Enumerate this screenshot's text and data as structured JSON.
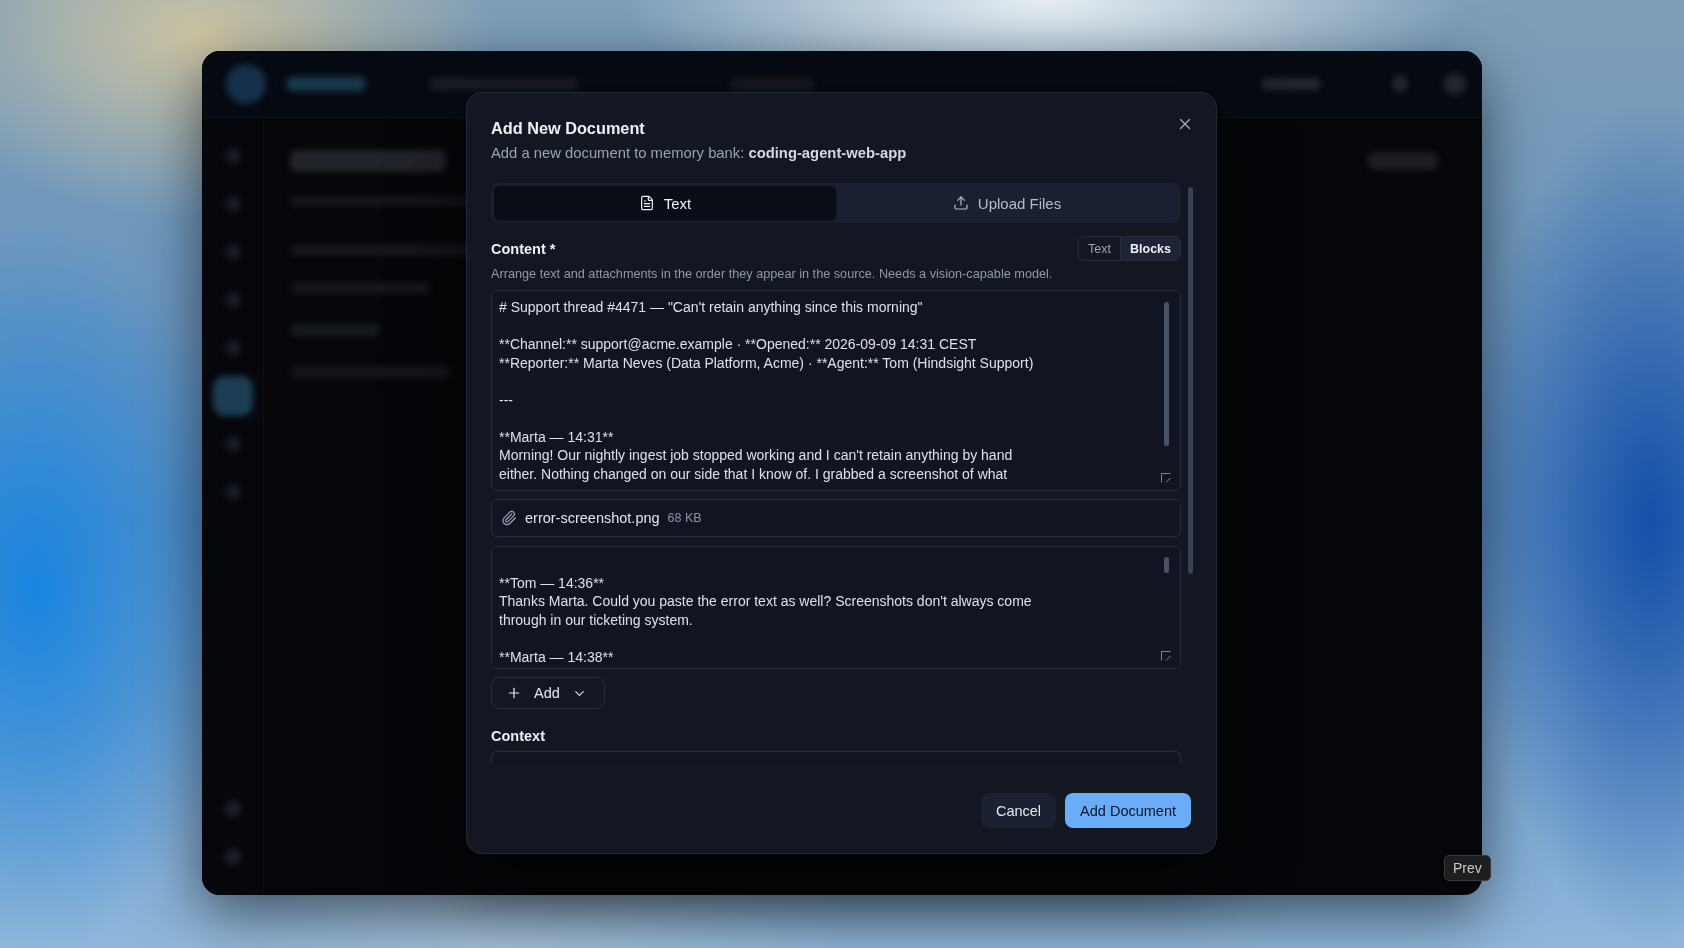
{
  "dialog": {
    "title": "Add New Document",
    "subtitle": "Add a new document to memory bank: **coding-agent-web-app**",
    "tabs": [
      {
        "kind": "text",
        "label": "Text",
        "selected": true
      },
      {
        "kind": "upload",
        "label": "Upload Files",
        "selected": false
      }
    ],
    "content": {
      "label": "Content *",
      "modes": [
        {
          "label": "Text",
          "selected": false
        },
        {
          "label": "Blocks",
          "selected": true
        }
      ],
      "hint": "Arrange text and attachments in the order they appear in the source. Needs a vision-capable model.",
      "blocks": [
        {
          "kind": "text",
          "value": "# Support thread #4471 — \"Can't retain anything since this morning\"\n\n**Channel:** support@acme.example · **Opened:** 2026-09-09 14:31 CEST\n**Reporter:** Marta Neves (Data Platform, Acme) · **Agent:** Tom (Hindsight Support)\n\n---\n\n**Marta — 14:31**\nMorning! Our nightly ingest job stopped working and I can't retain anything by hand\neither. Nothing changed on our side that I know of. I grabbed a screenshot of what"
        },
        {
          "kind": "attachment",
          "filename": "error-screenshot.png",
          "size": "68 KB"
        },
        {
          "kind": "text",
          "value": "\n**Tom — 14:36**\nThanks Marta. Could you paste the error text as well? Screenshots don't always come\nthrough in our ticketing system.\n\n**Marta — 14:38**"
        }
      ],
      "add_button": {
        "label": "Add"
      }
    },
    "context": {
      "label": "Context"
    },
    "buttons": [
      {
        "kind": "secondary",
        "label": "Cancel"
      },
      {
        "kind": "primary",
        "label": "Add Document"
      }
    ]
  },
  "prev_button": {
    "label": "Prev"
  }
}
